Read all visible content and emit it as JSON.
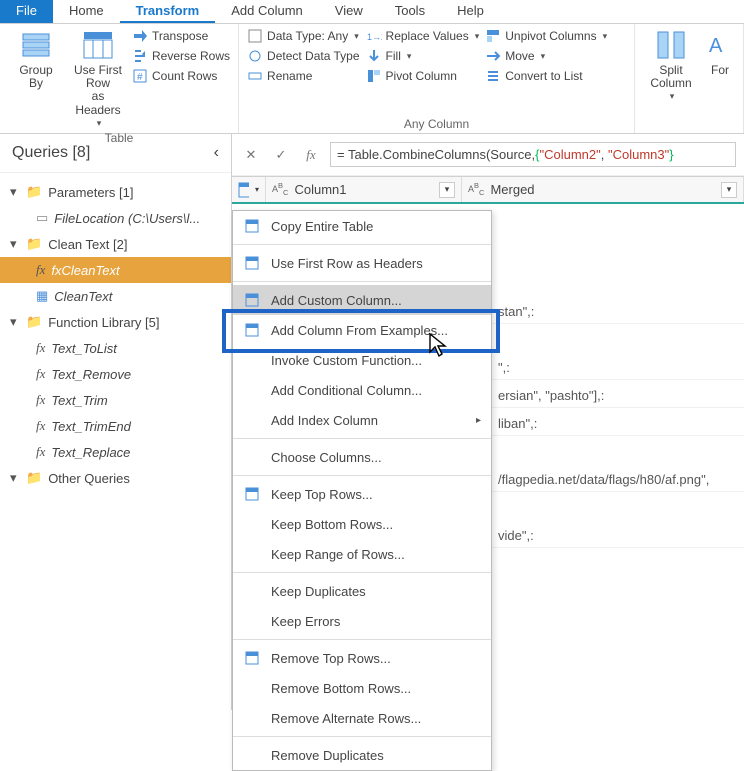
{
  "menubar": {
    "file": "File",
    "tabs": [
      "Home",
      "Transform",
      "Add Column",
      "View",
      "Tools",
      "Help"
    ],
    "active_index": 1
  },
  "ribbon": {
    "table_group": {
      "label": "Table",
      "group_by": "Group\nBy",
      "first_row": "Use First Row\nas Headers",
      "transpose": "Transpose",
      "reverse": "Reverse Rows",
      "count": "Count Rows"
    },
    "any_col_group": {
      "label": "Any Column",
      "data_type": "Data Type: Any",
      "detect": "Detect Data Type",
      "rename": "Rename",
      "replace": "Replace Values",
      "fill": "Fill",
      "pivot": "Pivot Column",
      "unpivot": "Unpivot Columns",
      "move": "Move",
      "convert": "Convert to List"
    },
    "text_group": {
      "split": "Split\nColumn",
      "format": "For"
    }
  },
  "queries": {
    "title": "Queries [8]",
    "nodes": [
      {
        "type": "folder",
        "label": "Parameters [1]"
      },
      {
        "type": "param",
        "label": "FileLocation (C:\\Users\\l...",
        "indent": true
      },
      {
        "type": "folder",
        "label": "Clean Text [2]"
      },
      {
        "type": "fx",
        "label": "fxCleanText",
        "indent": true,
        "selected": true
      },
      {
        "type": "table",
        "label": "CleanText",
        "indent": true
      },
      {
        "type": "folder",
        "label": "Function Library [5]"
      },
      {
        "type": "fx",
        "label": "Text_ToList",
        "indent": true
      },
      {
        "type": "fx",
        "label": "Text_Remove",
        "indent": true
      },
      {
        "type": "fx",
        "label": "Text_Trim",
        "indent": true
      },
      {
        "type": "fx",
        "label": "Text_TrimEnd",
        "indent": true
      },
      {
        "type": "fx",
        "label": "Text_Replace",
        "indent": true
      },
      {
        "type": "folder",
        "label": "Other Queries"
      }
    ]
  },
  "formula": {
    "prefix": "= Table.CombineColumns(Source,",
    "brace_open": "{",
    "q1": "\"Column2\"",
    "comma": ",  ",
    "q2": "\"Column3\"",
    "brace_close": "}"
  },
  "columns": {
    "col1": "Column1",
    "col2": "Merged"
  },
  "context_menu": [
    {
      "label": "Copy Entire Table",
      "icon": true
    },
    {
      "sep": true
    },
    {
      "label": "Use First Row as Headers",
      "icon": true
    },
    {
      "sep": true
    },
    {
      "label": "Add Custom Column...",
      "icon": true,
      "selected": true
    },
    {
      "label": "Add Column From Examples...",
      "icon": true
    },
    {
      "label": "Invoke Custom Function..."
    },
    {
      "label": "Add Conditional Column..."
    },
    {
      "label": "Add Index Column",
      "sub": true
    },
    {
      "sep": true
    },
    {
      "label": "Choose Columns..."
    },
    {
      "sep": true
    },
    {
      "label": "Keep Top Rows...",
      "icon": true
    },
    {
      "label": "Keep Bottom Rows..."
    },
    {
      "label": "Keep Range of Rows..."
    },
    {
      "sep": true
    },
    {
      "label": "Keep Duplicates"
    },
    {
      "label": "Keep Errors"
    },
    {
      "sep": true
    },
    {
      "label": "Remove Top Rows...",
      "icon": true
    },
    {
      "label": "Remove Bottom Rows..."
    },
    {
      "label": "Remove Alternate Rows..."
    },
    {
      "sep": true
    },
    {
      "label": "Remove Duplicates"
    }
  ],
  "data_peek": [
    "",
    "",
    "",
    "stan\",:",
    "",
    "\",:",
    "ersian\", \"pashto\"],:",
    "liban\",:",
    "",
    "/flagpedia.net/data/flags/h80/af.png\",",
    "",
    "vide\",:"
  ]
}
